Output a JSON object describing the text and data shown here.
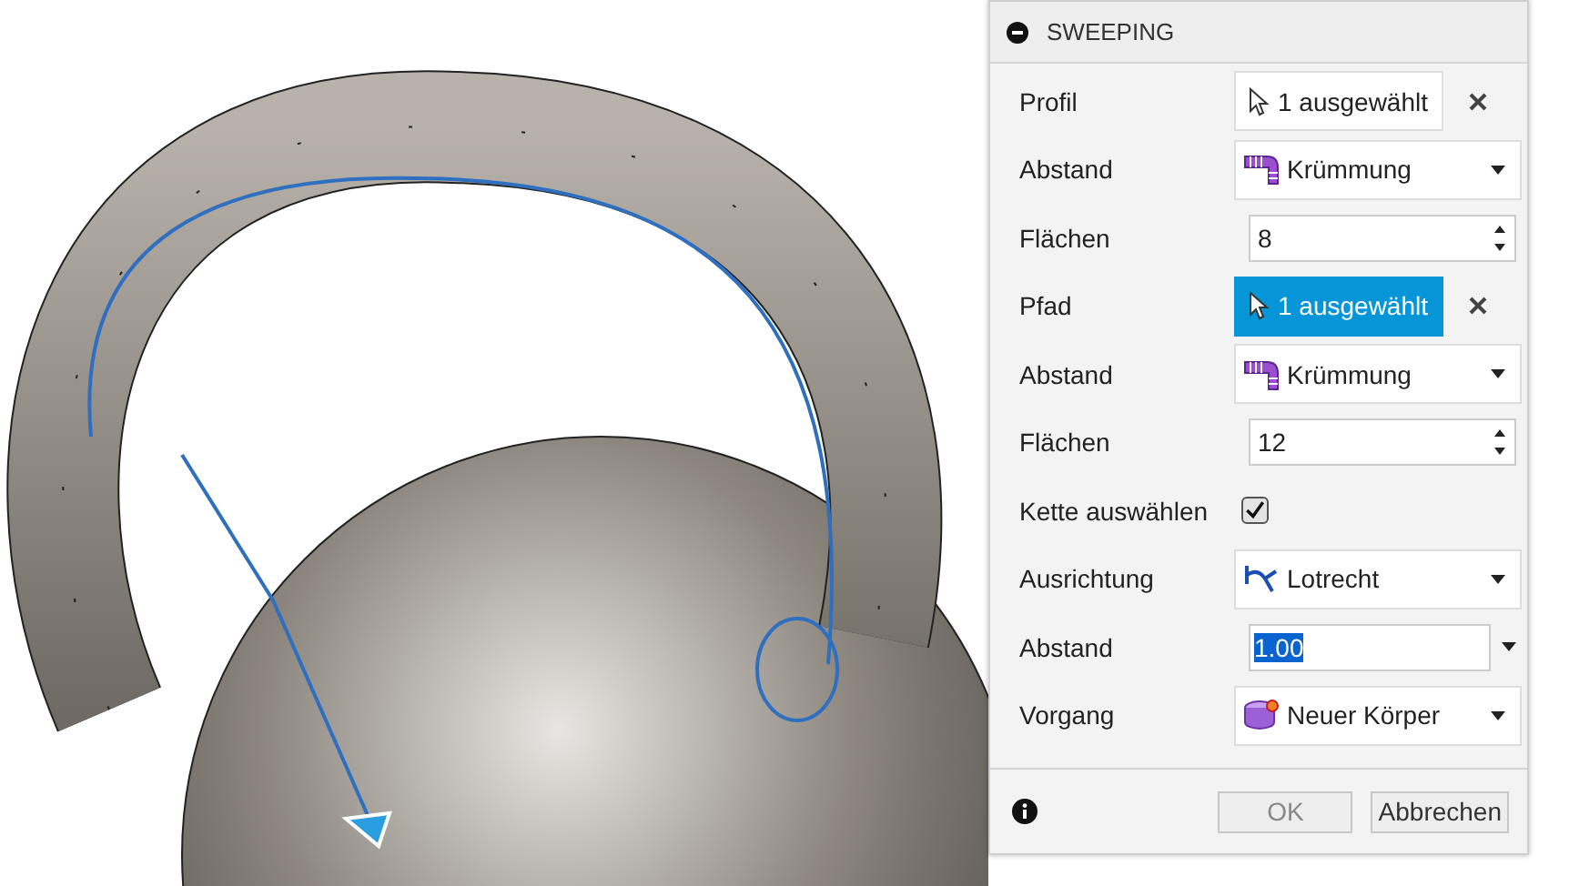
{
  "panel": {
    "title": "SWEEPING",
    "rows": [
      {
        "kind": "selection",
        "label": "Profil",
        "value": "1 ausgewählt",
        "selected": false
      },
      {
        "kind": "dropdown",
        "label": "Abstand",
        "value": "Krümmung"
      },
      {
        "kind": "spinner",
        "label": "Flächen",
        "value": "8"
      },
      {
        "kind": "selection",
        "label": "Pfad",
        "value": "1 ausgewählt",
        "selected": true
      },
      {
        "kind": "dropdown",
        "label": "Abstand",
        "value": "Krümmung"
      },
      {
        "kind": "spinner",
        "label": "Flächen",
        "value": "12"
      },
      {
        "kind": "checkbox",
        "label": "Kette auswählen",
        "checked": true
      },
      {
        "kind": "dropdown",
        "label": "Ausrichtung",
        "value": "Lotrecht"
      },
      {
        "kind": "combo",
        "label": "Abstand",
        "value": "1.00",
        "highlighted": true
      },
      {
        "kind": "dropdown",
        "label": "Vorgang",
        "value": "Neuer Körper"
      }
    ],
    "buttons": [
      {
        "label": "OK",
        "disabled": true
      },
      {
        "label": "Abbrechen",
        "disabled": false
      }
    ]
  }
}
